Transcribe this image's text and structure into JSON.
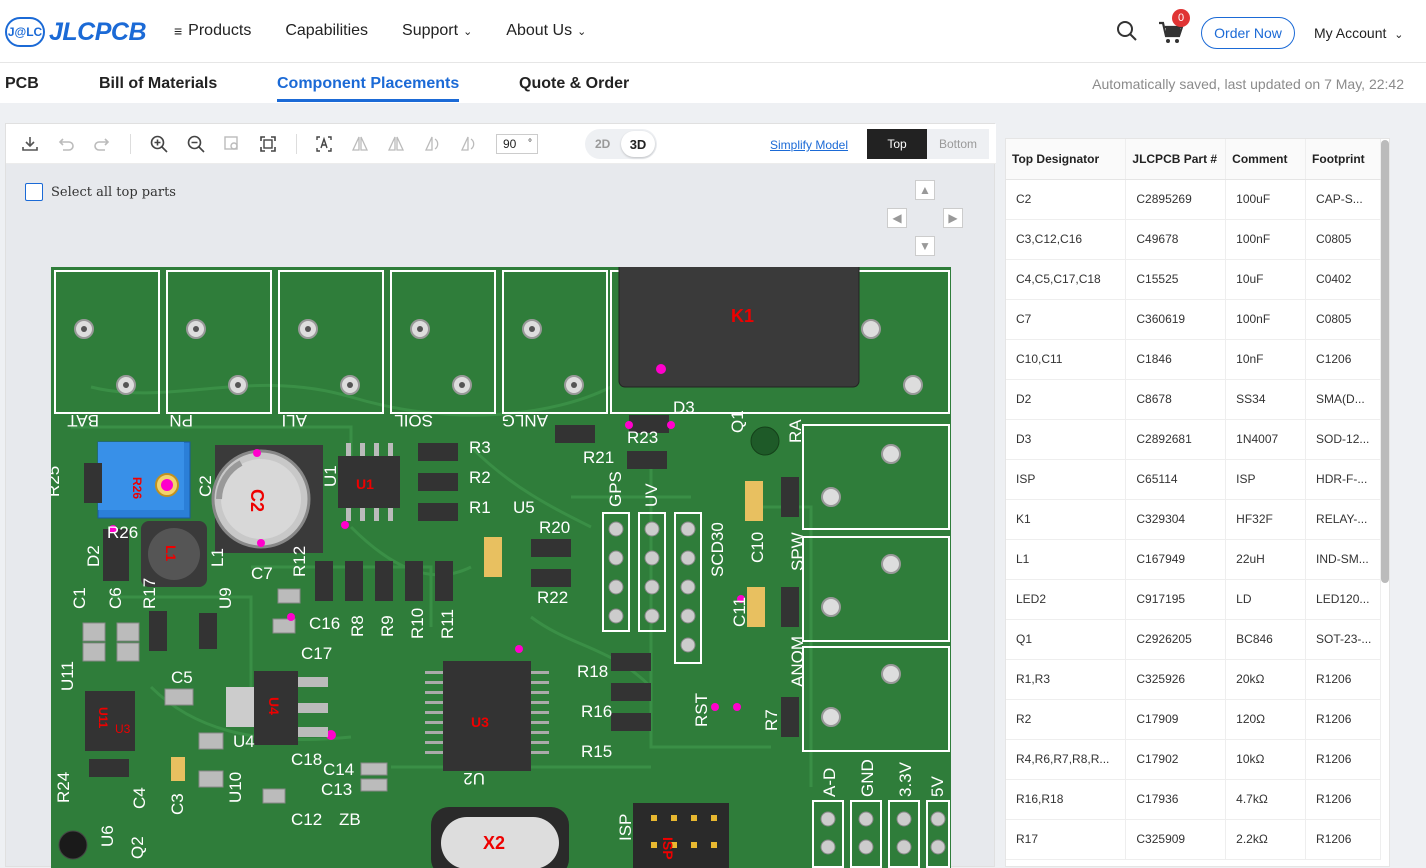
{
  "header": {
    "logo_badge": "J@LC",
    "logo_text": "JLCPCB",
    "nav": [
      {
        "label": "Products",
        "has_menu_icon": true
      },
      {
        "label": "Capabilities"
      },
      {
        "label": "Support",
        "has_chevron": true
      },
      {
        "label": "About Us",
        "has_chevron": true
      }
    ],
    "cart_count": "0",
    "order_now": "Order Now",
    "my_account": "My Account"
  },
  "tabs": [
    {
      "label": "PCB"
    },
    {
      "label": "Bill of Materials"
    },
    {
      "label": "Component Placements",
      "active": true
    },
    {
      "label": "Quote & Order"
    }
  ],
  "autosave_text": "Automatically saved, last updated on 7 May, 22:42",
  "toolbar": {
    "icons": [
      "download-icon",
      "undo-icon",
      "redo-icon",
      "zoom-in-icon",
      "zoom-out-icon",
      "zoom-area-icon",
      "fit-icon",
      "select-text-icon",
      "flip-icon-1",
      "flip-icon-2",
      "rotate-left-icon",
      "rotate-right-icon"
    ],
    "angle_value": "90",
    "angle_unit": "°",
    "view_2d": "2D",
    "view_3d": "3D",
    "simplify_model": "Simplify Model",
    "side_top": "Top",
    "side_bottom": "Bottom"
  },
  "select_all_label": "Select all top parts",
  "pcb_labels": {
    "terminals": [
      "BAT",
      "PN",
      "ALI",
      "SOIL",
      "ANLG"
    ],
    "relay": "K1",
    "parts": [
      "R25",
      "R26",
      "C2",
      "U1",
      "R3",
      "R2",
      "R1",
      "U5",
      "R21",
      "R23",
      "D3",
      "Q1",
      "RA",
      "D2",
      "L1",
      "R12",
      "C7",
      "C16",
      "R8",
      "R9",
      "R10",
      "R11",
      "R20",
      "R22",
      "GPS",
      "UV",
      "SCD30",
      "C10",
      "SPW",
      "C1",
      "C6",
      "R17",
      "U9",
      "C11",
      "C17",
      "U11",
      "C5",
      "U4",
      "U3",
      "R18",
      "R16",
      "R15",
      "RST",
      "R7",
      "ANOM",
      "R24",
      "C4",
      "C3",
      "U10",
      "C18",
      "C14",
      "C13",
      "U2",
      "C12",
      "ZB",
      "X2",
      "ISP",
      "A-D",
      "GND",
      "3.3V",
      "5V",
      "U6",
      "Q2"
    ]
  },
  "bom": {
    "columns": [
      "Top Designator",
      "JLCPCB Part #",
      "Comment",
      "Footprint"
    ],
    "rows": [
      [
        "C2",
        "C2895269",
        "100uF",
        "CAP-S..."
      ],
      [
        "C3,C12,C16",
        "C49678",
        "100nF",
        "C0805"
      ],
      [
        "C4,C5,C17,C18",
        "C15525",
        "10uF",
        "C0402"
      ],
      [
        "C7",
        "C360619",
        "100nF",
        "C0805"
      ],
      [
        "C10,C11",
        "C1846",
        "10nF",
        "C1206"
      ],
      [
        "D2",
        "C8678",
        "SS34",
        "SMA(D..."
      ],
      [
        "D3",
        "C2892681",
        "1N4007",
        "SOD-12..."
      ],
      [
        "ISP",
        "C65114",
        "ISP",
        "HDR-F-..."
      ],
      [
        "K1",
        "C329304",
        "HF32F",
        "RELAY-..."
      ],
      [
        "L1",
        "C167949",
        "22uH",
        "IND-SM..."
      ],
      [
        "LED2",
        "C917195",
        "LD",
        "LED120..."
      ],
      [
        "Q1",
        "C2926205",
        "BC846",
        "SOT-23-..."
      ],
      [
        "R1,R3",
        "C325926",
        "20kΩ",
        "R1206"
      ],
      [
        "R2",
        "C17909",
        "120Ω",
        "R1206"
      ],
      [
        "R4,R6,R7,R8,R...",
        "C17902",
        "10kΩ",
        "R1206"
      ],
      [
        "R16,R18",
        "C17936",
        "4.7kΩ",
        "R1206"
      ],
      [
        "R17",
        "C325909",
        "2.2kΩ",
        "R1206"
      ]
    ]
  },
  "colors": {
    "accent": "#1b6ad6",
    "pcb_green": "#2f7d3a",
    "trace_green": "#3a8c45",
    "silk": "#ffffff",
    "chip": "#333333",
    "marker": "#ff00cc"
  }
}
